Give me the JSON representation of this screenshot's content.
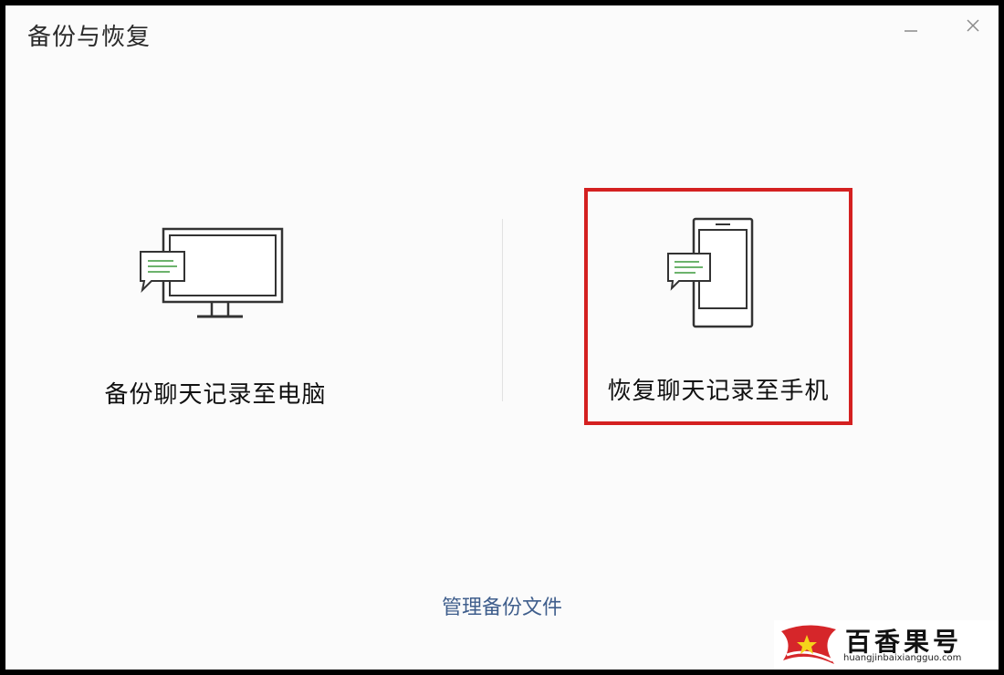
{
  "window": {
    "title": "备份与恢复",
    "minimize_icon": "minimize-icon",
    "close_icon": "close-icon"
  },
  "options": {
    "backup_to_pc": {
      "label": "备份聊天记录至电脑",
      "icon": "monitor-chat-icon"
    },
    "restore_to_phone": {
      "label": "恢复聊天记录至手机",
      "icon": "phone-chat-icon",
      "highlighted": true
    }
  },
  "footer": {
    "manage_link": "管理备份文件"
  },
  "watermark": {
    "title": "百香果号",
    "url": "huangjinbaixiangguo.com",
    "logo": "star-logo"
  },
  "colors": {
    "background": "#fbfbfb",
    "highlight_border": "#d42020",
    "link": "#3f5e8c",
    "chat_lines": "#3c9a3c",
    "icon_stroke": "#333333"
  }
}
